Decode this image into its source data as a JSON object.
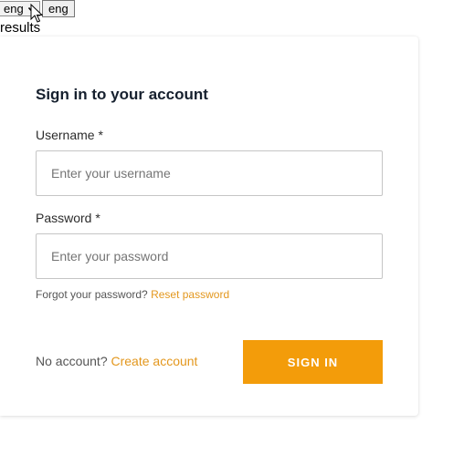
{
  "topbar": {
    "language_select_value": "eng",
    "language_button_label": "eng"
  },
  "results_text": "results",
  "signin_form": {
    "title": "Sign in to your account",
    "username_label": "Username *",
    "username_placeholder": "Enter your username",
    "password_label": "Password *",
    "password_placeholder": "Enter your password",
    "forgot_text": "Forgot your password?",
    "reset_link": "Reset password",
    "no_account_text": "No account?",
    "create_account_link": "Create account",
    "signin_button_label": "SIGN IN"
  },
  "colors": {
    "accent": "#f39c0a",
    "link": "#e3971d",
    "title": "#16202e"
  }
}
